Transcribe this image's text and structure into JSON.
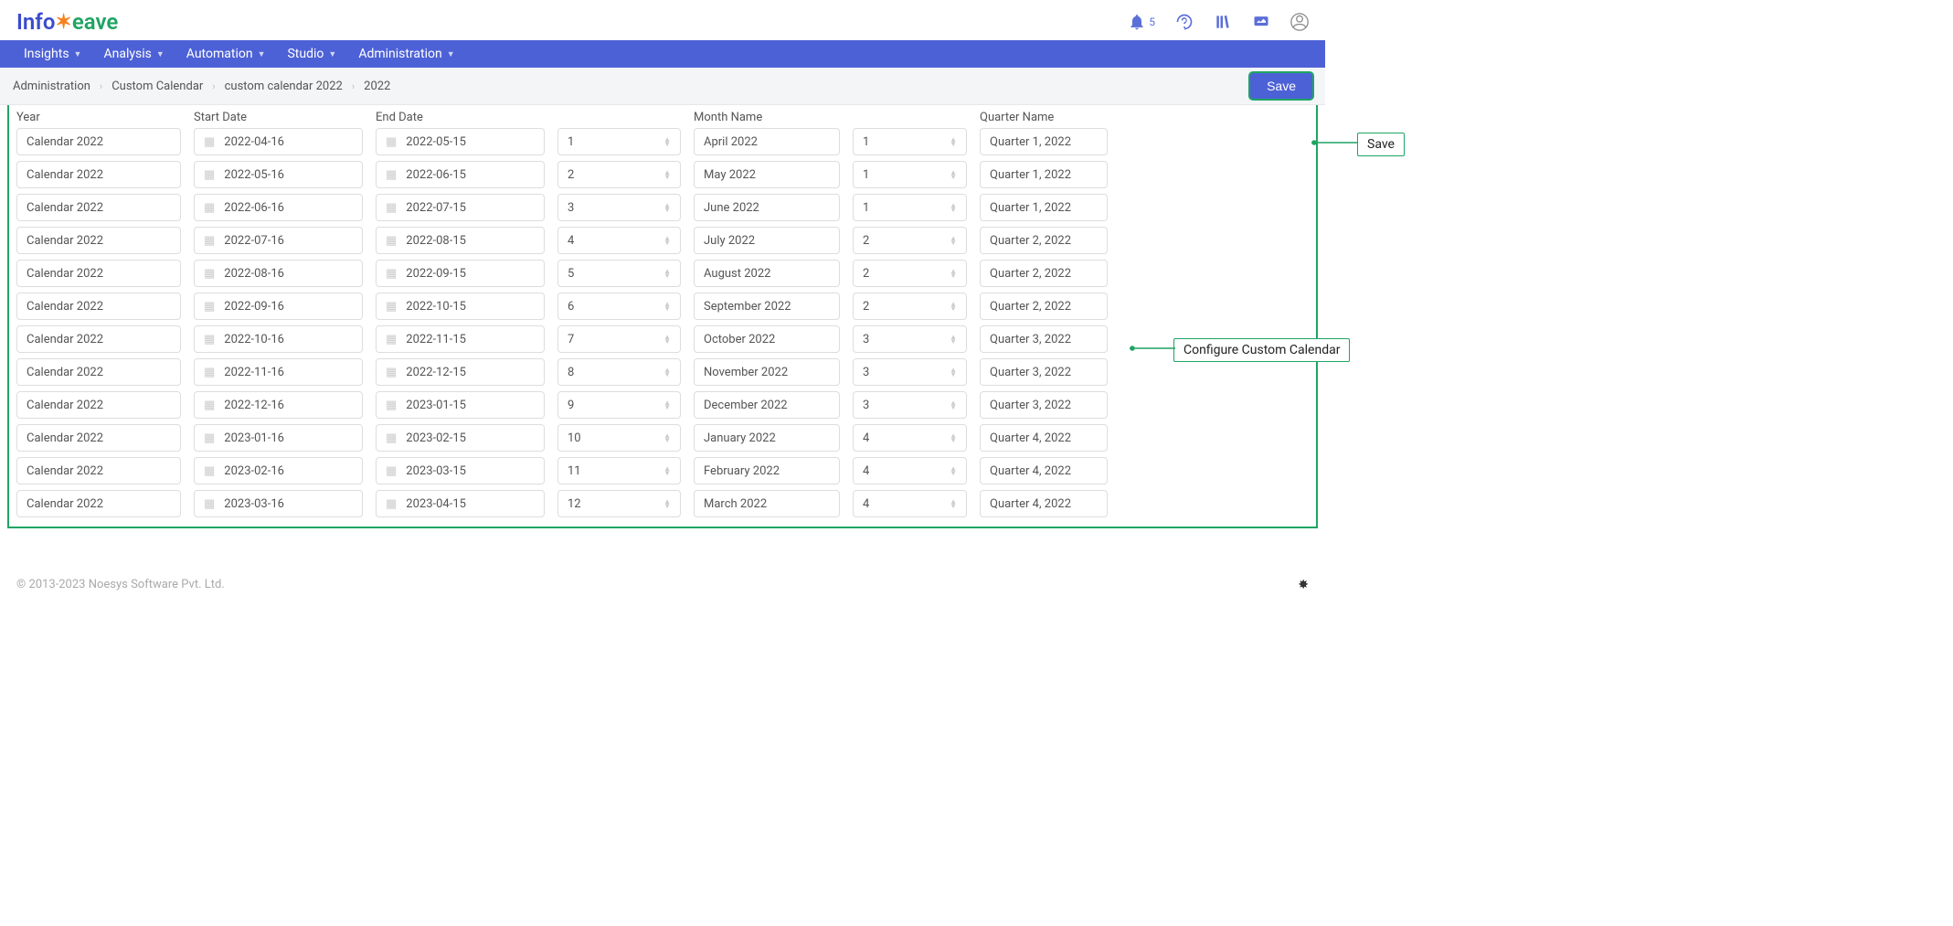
{
  "logo": {
    "part1": "Info",
    "part2": "eave"
  },
  "topbar": {
    "notification_count": "5"
  },
  "nav": {
    "items": [
      "Insights",
      "Analysis",
      "Automation",
      "Studio",
      "Administration"
    ]
  },
  "breadcrumb": {
    "items": [
      "Administration",
      "Custom Calendar",
      "custom calendar 2022",
      "2022"
    ]
  },
  "save_label": "Save",
  "callouts": {
    "save": "Save",
    "configure": "Configure Custom Calendar"
  },
  "columns": {
    "year": "Year",
    "start_date": "Start Date",
    "end_date": "End Date",
    "month_num": "",
    "month_name": "Month Name",
    "quarter_num": "",
    "quarter_name": "Quarter Name"
  },
  "rows": [
    {
      "year": "Calendar 2022",
      "start": "2022-04-16",
      "end": "2022-05-15",
      "mnum": "1",
      "mname": "April 2022",
      "qnum": "1",
      "qname": "Quarter 1, 2022"
    },
    {
      "year": "Calendar 2022",
      "start": "2022-05-16",
      "end": "2022-06-15",
      "mnum": "2",
      "mname": "May 2022",
      "qnum": "1",
      "qname": "Quarter 1, 2022"
    },
    {
      "year": "Calendar 2022",
      "start": "2022-06-16",
      "end": "2022-07-15",
      "mnum": "3",
      "mname": "June 2022",
      "qnum": "1",
      "qname": "Quarter 1, 2022"
    },
    {
      "year": "Calendar 2022",
      "start": "2022-07-16",
      "end": "2022-08-15",
      "mnum": "4",
      "mname": "July 2022",
      "qnum": "2",
      "qname": "Quarter 2, 2022"
    },
    {
      "year": "Calendar 2022",
      "start": "2022-08-16",
      "end": "2022-09-15",
      "mnum": "5",
      "mname": "August 2022",
      "qnum": "2",
      "qname": "Quarter 2, 2022"
    },
    {
      "year": "Calendar 2022",
      "start": "2022-09-16",
      "end": "2022-10-15",
      "mnum": "6",
      "mname": "September 2022",
      "qnum": "2",
      "qname": "Quarter 2, 2022"
    },
    {
      "year": "Calendar 2022",
      "start": "2022-10-16",
      "end": "2022-11-15",
      "mnum": "7",
      "mname": "October 2022",
      "qnum": "3",
      "qname": "Quarter 3, 2022"
    },
    {
      "year": "Calendar 2022",
      "start": "2022-11-16",
      "end": "2022-12-15",
      "mnum": "8",
      "mname": "November 2022",
      "qnum": "3",
      "qname": "Quarter 3, 2022"
    },
    {
      "year": "Calendar 2022",
      "start": "2022-12-16",
      "end": "2023-01-15",
      "mnum": "9",
      "mname": "December 2022",
      "qnum": "3",
      "qname": "Quarter 3, 2022"
    },
    {
      "year": "Calendar 2022",
      "start": "2023-01-16",
      "end": "2023-02-15",
      "mnum": "10",
      "mname": "January 2022",
      "qnum": "4",
      "qname": "Quarter 4, 2022"
    },
    {
      "year": "Calendar 2022",
      "start": "2023-02-16",
      "end": "2023-03-15",
      "mnum": "11",
      "mname": "February 2022",
      "qnum": "4",
      "qname": "Quarter 4, 2022"
    },
    {
      "year": "Calendar 2022",
      "start": "2023-03-16",
      "end": "2023-04-15",
      "mnum": "12",
      "mname": "March 2022",
      "qnum": "4",
      "qname": "Quarter 4, 2022"
    }
  ],
  "footer": "© 2013-2023 Noesys Software Pvt. Ltd."
}
